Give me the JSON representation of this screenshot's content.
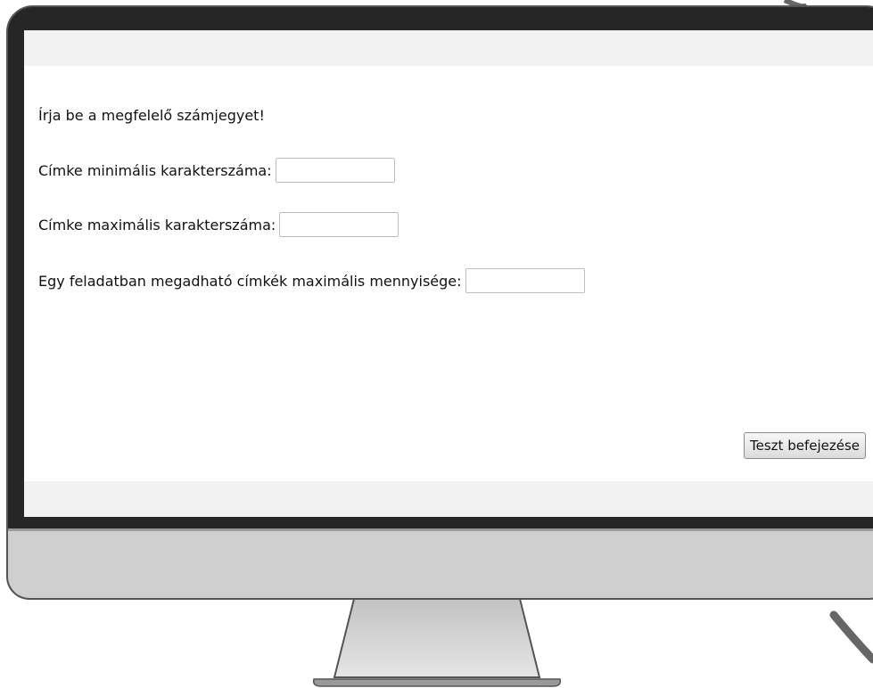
{
  "instruction": "Írja be a megfelelő számjegyet!",
  "fields": [
    {
      "label": "Címke minimális karakterszáma:",
      "value": ""
    },
    {
      "label": "Címke maximális karakterszáma:",
      "value": ""
    },
    {
      "label": "Egy feladatban megadható címkék maximális mennyisége:",
      "value": ""
    }
  ],
  "finish_button": "Teszt befejezése",
  "colors": {
    "bezel": "#262626",
    "chin": "#cfcfcf",
    "screen_band": "#f2f2f2"
  }
}
